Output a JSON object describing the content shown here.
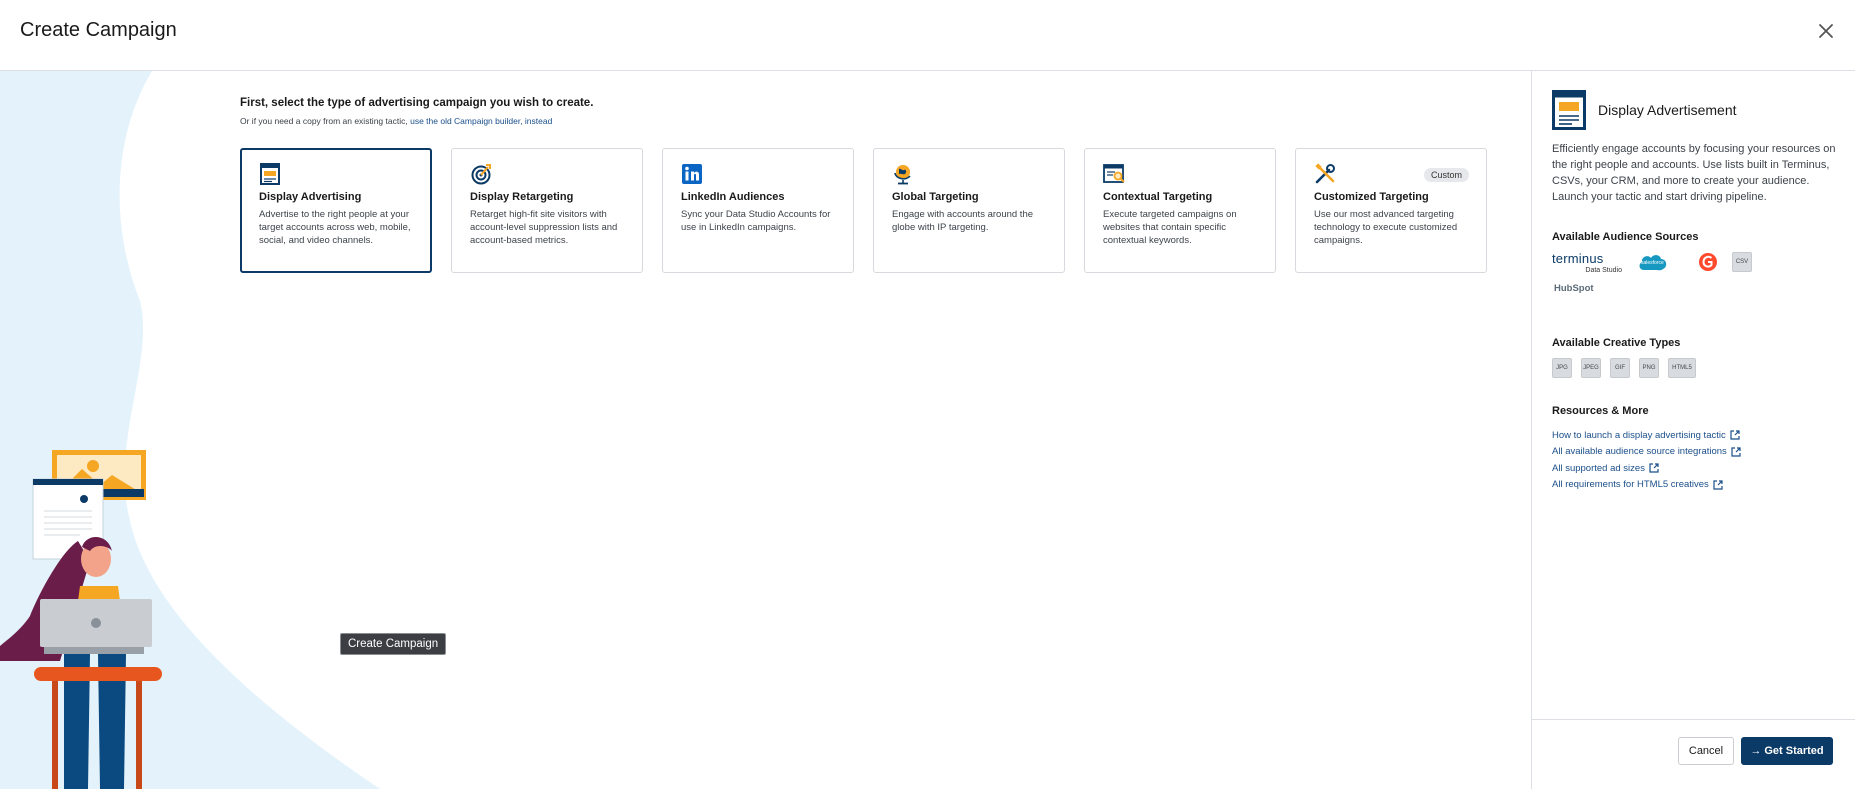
{
  "header": {
    "title": "Create Campaign"
  },
  "intro": {
    "title": "First, select the type of advertising campaign you wish to create.",
    "sub_prefix": "Or if you need a copy from an existing tactic,",
    "sub_link": "use the old Campaign builder, instead"
  },
  "cards": [
    {
      "title": "Display Advertising",
      "desc": "Advertise to the right people at your target accounts across web, mobile, social, and video channels.",
      "icon": "display-ad-icon",
      "selected": true
    },
    {
      "title": "Display Retargeting",
      "desc": "Retarget high-fit site visitors with account-level suppression lists and account-based metrics.",
      "icon": "retargeting-icon"
    },
    {
      "title": "LinkedIn Audiences",
      "desc": "Sync your Data Studio Accounts for use in LinkedIn campaigns.",
      "icon": "linkedin-icon"
    },
    {
      "title": "Global Targeting",
      "desc": "Engage with accounts around the globe with IP targeting.",
      "icon": "globe-icon"
    },
    {
      "title": "Contextual Targeting",
      "desc": "Execute targeted campaigns on websites that contain specific contextual keywords.",
      "icon": "contextual-icon"
    },
    {
      "title": "Customized Targeting",
      "desc": "Use our most advanced targeting technology to execute customized campaigns.",
      "icon": "tools-icon",
      "tag": "Custom"
    }
  ],
  "tooltip": "Create Campaign",
  "side": {
    "title": "Display Advertisement",
    "description": "Efficiently engage accounts by focusing your resources on the right people and accounts. Use lists built in Terminus, CSVs, your CRM, and more to create your audience. Launch your tactic and start driving pipeline.",
    "sources_title": "Available Audience Sources",
    "sources": {
      "terminus": "terminus",
      "terminus_sub": "Data Studio",
      "salesforce": "salesforce",
      "csv": "CSV",
      "hubspot": "HubSpot"
    },
    "creatives_title": "Available Creative Types",
    "creatives": [
      "JPG",
      "JPEG",
      "GIF",
      "PNG",
      "HTML5"
    ],
    "resources_title": "Resources & More",
    "links": [
      "How to launch a display advertising tactic",
      "All available audience source integrations",
      "All supported ad sizes",
      "All requirements for HTML5 creatives"
    ]
  },
  "footer": {
    "cancel": "Cancel",
    "start": "Get Started",
    "start_arrow": "→"
  },
  "colors": {
    "primary": "#0b3a66",
    "accent_orange": "#f5a623",
    "link": "#1b4f8a",
    "illus_bg": "#e4f3fb"
  }
}
